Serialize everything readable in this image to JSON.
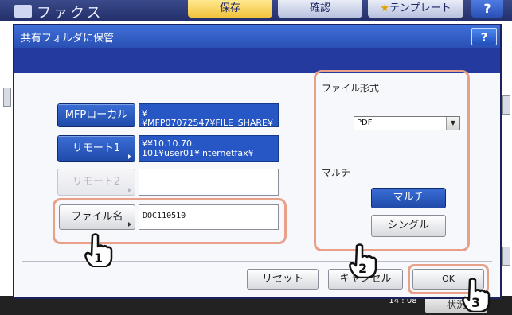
{
  "background": {
    "app_title": "ファクス",
    "tabs": [
      {
        "label": "保存"
      },
      {
        "label": "確認"
      },
      {
        "label": "テンプレート"
      }
    ],
    "help_label": "?",
    "status_button": "状況",
    "time": "14 : 08"
  },
  "dialog": {
    "title": "共有フォルダに保管",
    "help_label": "?",
    "destinations": {
      "mfp_local": {
        "label": "MFPローカル",
        "value": "¥¥MFP07072547¥FILE_SHARE¥"
      },
      "remote1": {
        "label": "リモート1",
        "value_line1": "¥¥10.10.70.",
        "value_line2": "101¥user01¥internetfax¥"
      },
      "remote2": {
        "label": "リモート2",
        "value": ""
      },
      "file_name": {
        "label": "ファイル名",
        "value": "DOC110510"
      }
    },
    "file_format": {
      "label": "ファイル形式",
      "selected": "PDF"
    },
    "multi": {
      "label": "マルチ",
      "multi_button": "マルチ",
      "single_button": "シングル"
    },
    "footer": {
      "reset": "リセット",
      "cancel": "キャンセル",
      "ok": "OK"
    }
  },
  "callouts": [
    "1",
    "2",
    "3"
  ]
}
